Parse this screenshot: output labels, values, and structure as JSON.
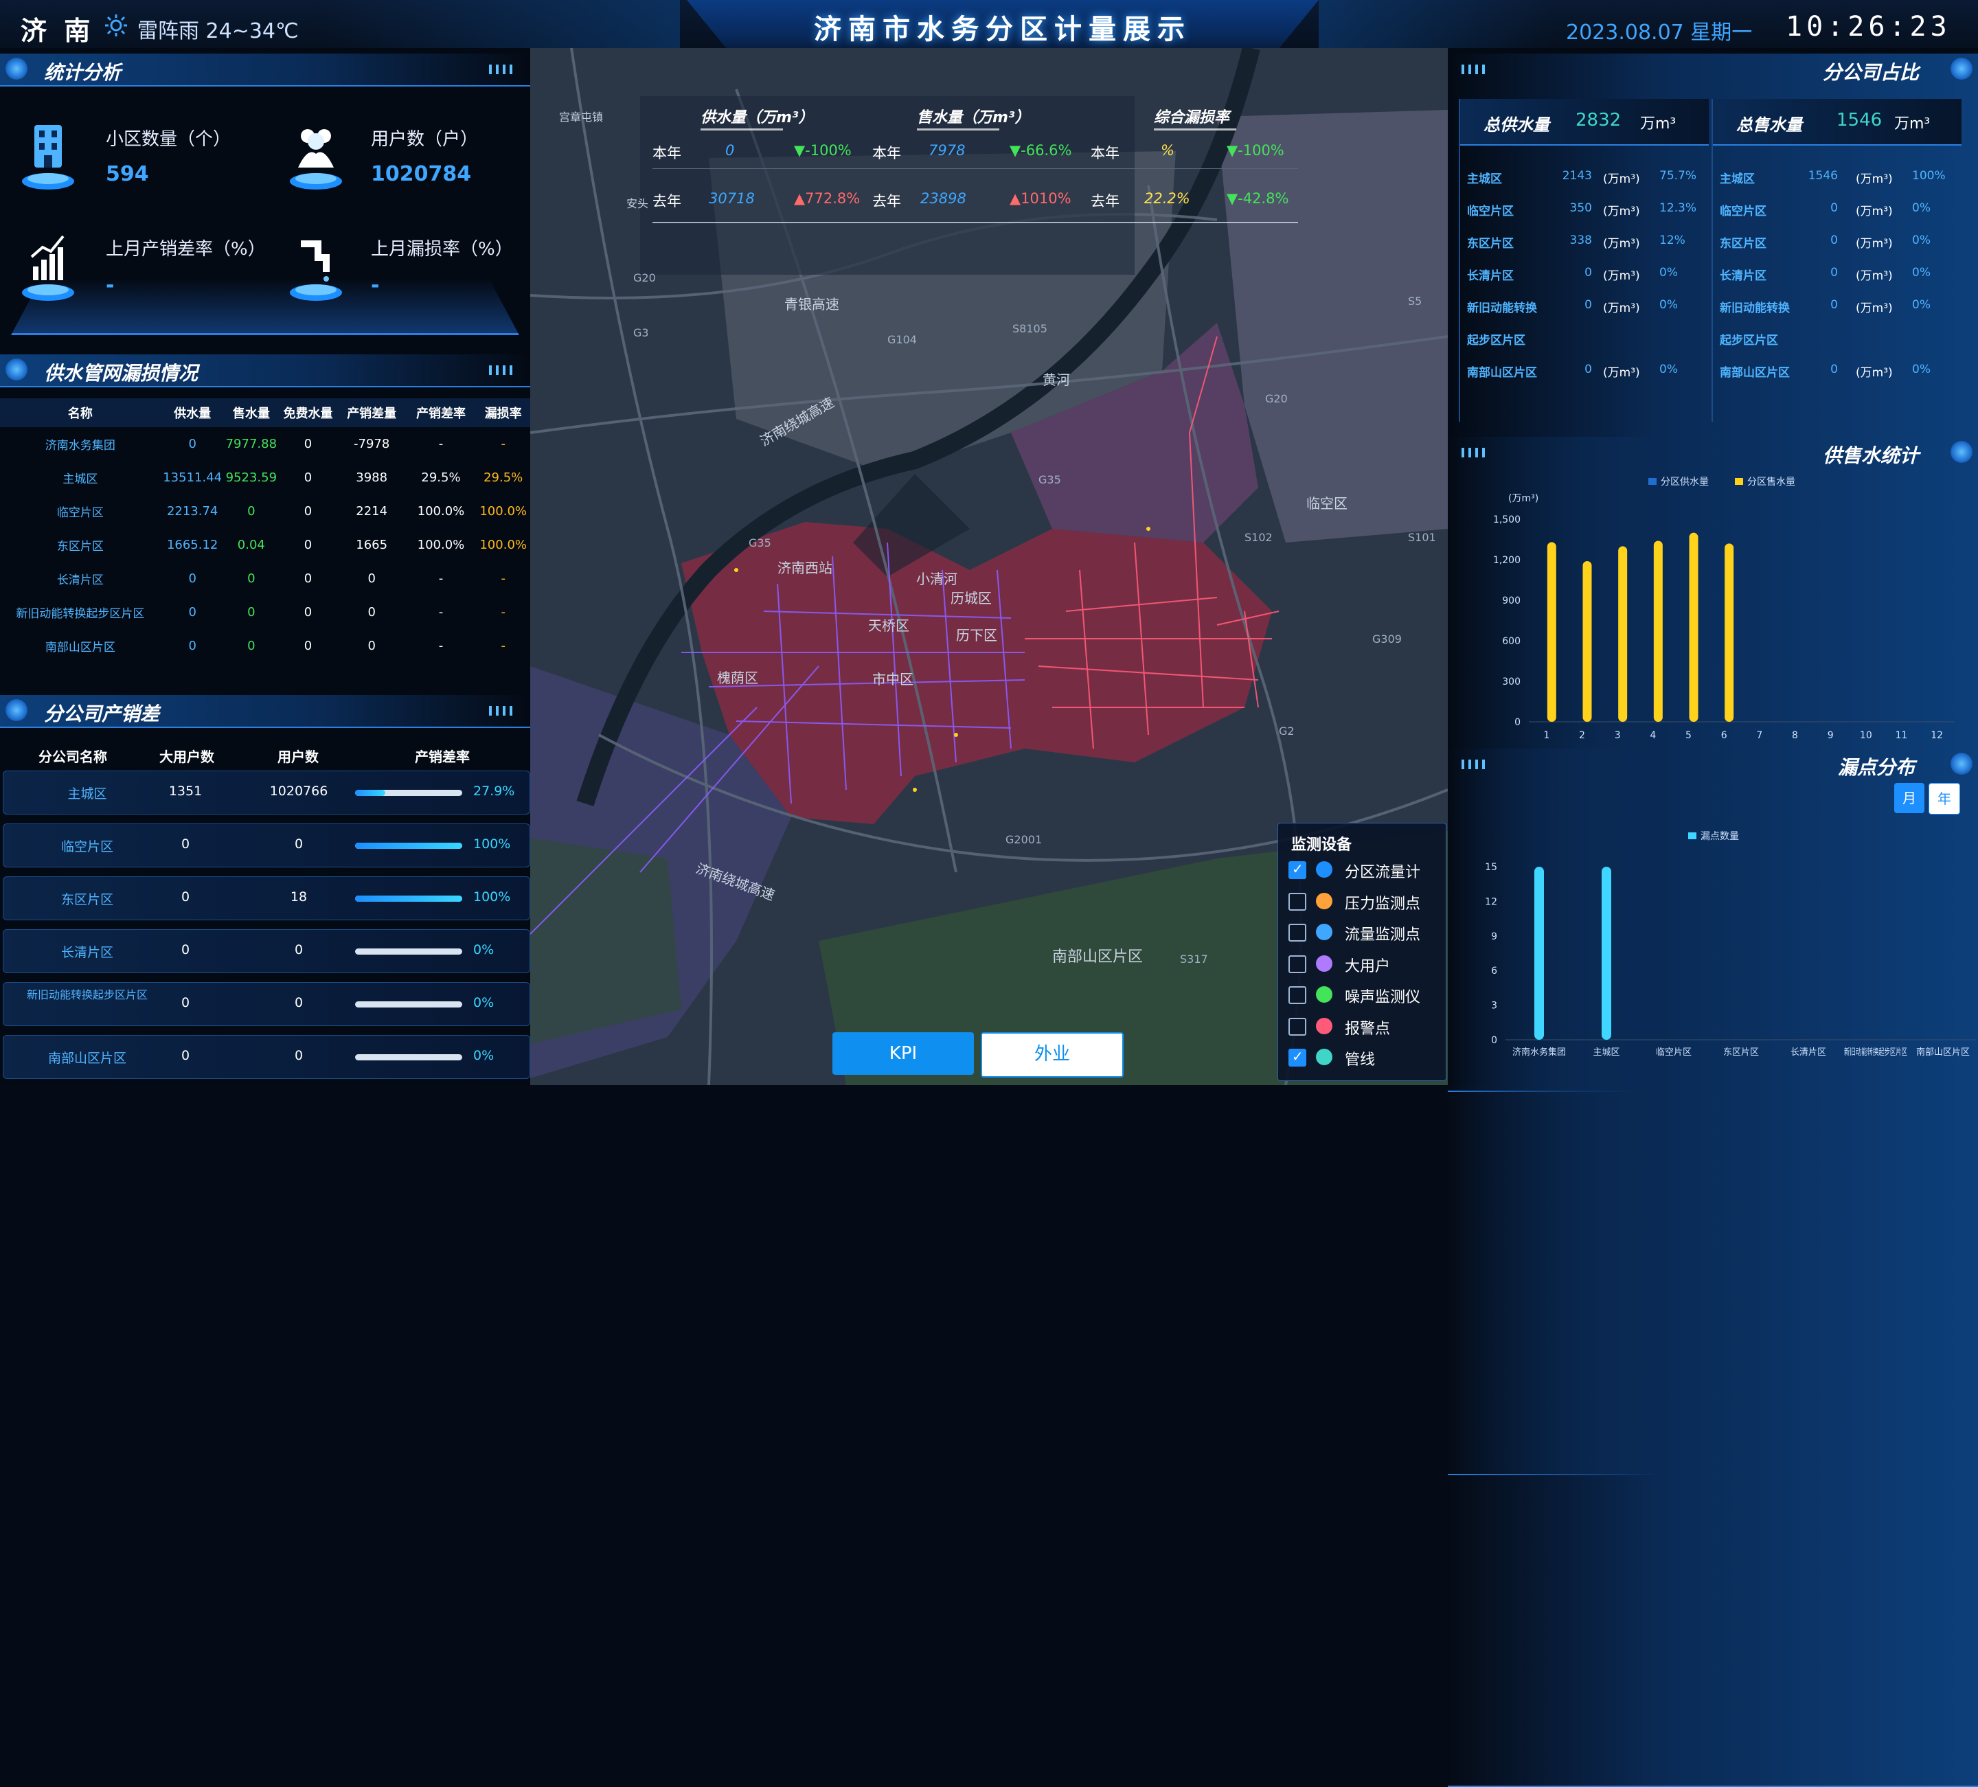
{
  "header": {
    "city": "济 南",
    "weather": "雷阵雨 24~34℃",
    "title": "济南市水务分区计量展示",
    "date": "2023.08.07 星期一",
    "time": "10:26:23"
  },
  "stats": {
    "title": "统计分析",
    "items": [
      {
        "label": "小区数量（个）",
        "value": "594",
        "icon": "building-icon"
      },
      {
        "label": "用户数（户）",
        "value": "1020784",
        "icon": "users-icon"
      },
      {
        "label": "上月产销差率（%）",
        "value": "-",
        "icon": "chart-up-icon"
      },
      {
        "label": "上月漏损率（%）",
        "value": "-",
        "icon": "faucet-icon"
      }
    ]
  },
  "leak": {
    "title": "供水管网漏损情况",
    "columns": [
      "名称",
      "供水量",
      "售水量",
      "免费水量",
      "产销差量",
      "产销差率",
      "漏损率"
    ],
    "rows": [
      [
        "济南水务集团",
        "0",
        "7977.88",
        "0",
        "-7978",
        "-",
        "-"
      ],
      [
        "主城区",
        "13511.44",
        "9523.59",
        "0",
        "3988",
        "29.5%",
        "29.5%"
      ],
      [
        "临空片区",
        "2213.74",
        "0",
        "0",
        "2214",
        "100.0%",
        "100.0%"
      ],
      [
        "东区片区",
        "1665.12",
        "0.04",
        "0",
        "1665",
        "100.0%",
        "100.0%"
      ],
      [
        "长清片区",
        "0",
        "0",
        "0",
        "0",
        "-",
        "-"
      ],
      [
        "新旧动能转换起步区片区",
        "0",
        "0",
        "0",
        "0",
        "-",
        "-"
      ],
      [
        "南部山区片区",
        "0",
        "0",
        "0",
        "0",
        "-",
        "-"
      ]
    ]
  },
  "prod": {
    "title": "分公司产销差",
    "columns": [
      "分公司名称",
      "大用户数",
      "用户数",
      "产销差率"
    ],
    "rows": [
      {
        "name": "主城区",
        "big": "1351",
        "users": "1020766",
        "rate": "27.9%",
        "pct": 27.9
      },
      {
        "name": "临空片区",
        "big": "0",
        "users": "0",
        "rate": "100%",
        "pct": 100
      },
      {
        "name": "东区片区",
        "big": "0",
        "users": "18",
        "rate": "100%",
        "pct": 100
      },
      {
        "name": "长清片区",
        "big": "0",
        "users": "0",
        "rate": "0%",
        "pct": 0
      },
      {
        "name": "新旧动能转换起步区片区",
        "big": "0",
        "users": "0",
        "rate": "0%",
        "pct": 0
      },
      {
        "name": "南部山区片区",
        "big": "0",
        "users": "0",
        "rate": "0%",
        "pct": 0
      }
    ]
  },
  "kpi": {
    "headers": [
      "供水量（万m³）",
      "售水量（万m³）",
      "综合漏损率"
    ],
    "this_year": "本年",
    "last_year": "去年",
    "supply_this": "0",
    "supply_this_chg": "▼-100%",
    "supply_last": "30718",
    "supply_last_chg": "▲772.8%",
    "sale_this": "7978",
    "sale_this_chg": "▼-66.6%",
    "sale_last": "23898",
    "sale_last_chg": "▲1010%",
    "loss_this": "%",
    "loss_this_chg": "▼-100%",
    "loss_last": "22.2%",
    "loss_last_chg": "▼-42.8%"
  },
  "map": {
    "labels": [
      "黄河",
      "青银高速",
      "济南绕城高速",
      "天桥区",
      "历城区",
      "历下区",
      "市中区",
      "槐荫区",
      "小清河",
      "南部山区片区",
      "临空区",
      "济南西站",
      "宫章屯镇",
      "济南绕城高速",
      "安头"
    ],
    "roads": [
      "G3",
      "G20",
      "G104",
      "S8105",
      "G35",
      "G2",
      "G309",
      "S102",
      "S101",
      "G2001",
      "S317",
      "G35",
      "G20",
      "S5"
    ]
  },
  "legend": {
    "title": "监测设备",
    "items": [
      {
        "label": "分区流量计",
        "checked": true,
        "color": "#1e8fff"
      },
      {
        "label": "压力监测点",
        "checked": false,
        "color": "#ffa23a"
      },
      {
        "label": "流量监测点",
        "checked": false,
        "color": "#3fa7ff"
      },
      {
        "label": "大用户",
        "checked": false,
        "color": "#b07aff"
      },
      {
        "label": "噪声监测仪",
        "checked": false,
        "color": "#43e35a"
      },
      {
        "label": "报警点",
        "checked": false,
        "color": "#ff5a7a"
      },
      {
        "label": "管线",
        "checked": true,
        "color": "#3fd6c8"
      }
    ]
  },
  "buttons": {
    "kpi": "KPI",
    "field": "外业"
  },
  "share": {
    "title": "分公司占比",
    "supply_label": "总供水量",
    "supply_value": "2832",
    "supply_unit": "万m³",
    "sale_label": "总售水量",
    "sale_value": "1546",
    "sale_unit": "万m³",
    "unit_small": "(万m³)",
    "supply_rows": [
      [
        "主城区",
        "2143",
        "75.7%"
      ],
      [
        "临空片区",
        "350",
        "12.3%"
      ],
      [
        "东区片区",
        "338",
        "12%"
      ],
      [
        "长清片区",
        "0",
        "0%"
      ],
      [
        "新旧动能转换",
        "0",
        "0%"
      ],
      [
        "起步区片区",
        "",
        ""
      ],
      [
        "南部山区片区",
        "0",
        "0%"
      ]
    ],
    "sale_rows": [
      [
        "主城区",
        "1546",
        "100%"
      ],
      [
        "临空片区",
        "0",
        "0%"
      ],
      [
        "东区片区",
        "0",
        "0%"
      ],
      [
        "长清片区",
        "0",
        "0%"
      ],
      [
        "新旧动能转换",
        "0",
        "0%"
      ],
      [
        "起步区片区",
        "",
        ""
      ],
      [
        "南部山区片区",
        "0",
        "0%"
      ]
    ]
  },
  "supply_stats": {
    "title": "供售水统计"
  },
  "leak_dist": {
    "title": "漏点分布",
    "tab_month": "月",
    "tab_year": "年"
  },
  "chart_data": [
    {
      "type": "bar",
      "title": "",
      "ylabel": "(万m³)",
      "categories": [
        "1",
        "2",
        "3",
        "4",
        "5",
        "6",
        "7",
        "8",
        "9",
        "10",
        "11",
        "12"
      ],
      "ylim": [
        0,
        1500
      ],
      "yticks": [
        "0",
        "300",
        "600",
        "900",
        "1,200",
        "1,500"
      ],
      "series": [
        {
          "name": "分区供水量",
          "values": [
            0,
            0,
            0,
            0,
            0,
            0,
            0,
            0,
            0,
            0,
            0,
            0
          ],
          "color": "#1e6fd0"
        },
        {
          "name": "分区售水量",
          "values": [
            1330,
            1190,
            1300,
            1340,
            1400,
            1320,
            0,
            0,
            0,
            0,
            0,
            0
          ],
          "color": "#ffd21c"
        }
      ]
    },
    {
      "type": "bar",
      "title": "",
      "categories": [
        "济南水务集团",
        "主城区",
        "临空片区",
        "东区片区",
        "长清片区",
        "新旧动能转换起步区片区",
        "南部山区片区"
      ],
      "ylim": [
        0,
        15
      ],
      "yticks": [
        "0",
        "3",
        "6",
        "9",
        "12",
        "15"
      ],
      "series": [
        {
          "name": "漏点数量",
          "values": [
            15,
            15,
            0,
            0,
            0,
            0,
            0
          ],
          "color": "#3fd6ff"
        }
      ]
    }
  ]
}
